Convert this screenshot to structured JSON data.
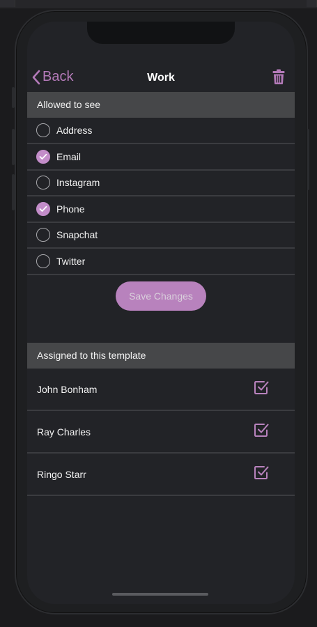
{
  "colors": {
    "accent": "#b882bd",
    "background": "#222327",
    "header": "#464749"
  },
  "navbar": {
    "back_label": "Back",
    "title": "Work",
    "back_icon": "chevron-left-icon",
    "delete_icon": "trash-icon"
  },
  "visibility_section": {
    "header": "Allowed to see",
    "options": [
      {
        "label": "Address",
        "checked": false
      },
      {
        "label": "Email",
        "checked": true
      },
      {
        "label": "Instagram",
        "checked": false
      },
      {
        "label": "Phone",
        "checked": true
      },
      {
        "label": "Snapchat",
        "checked": false
      },
      {
        "label": "Twitter",
        "checked": false
      }
    ],
    "save_label": "Save Changes"
  },
  "assigned_section": {
    "header": "Assigned to this template",
    "people": [
      {
        "name": "John Bonham",
        "checked": true
      },
      {
        "name": "Ray Charles",
        "checked": true
      },
      {
        "name": "Ringo Starr",
        "checked": true
      }
    ]
  }
}
